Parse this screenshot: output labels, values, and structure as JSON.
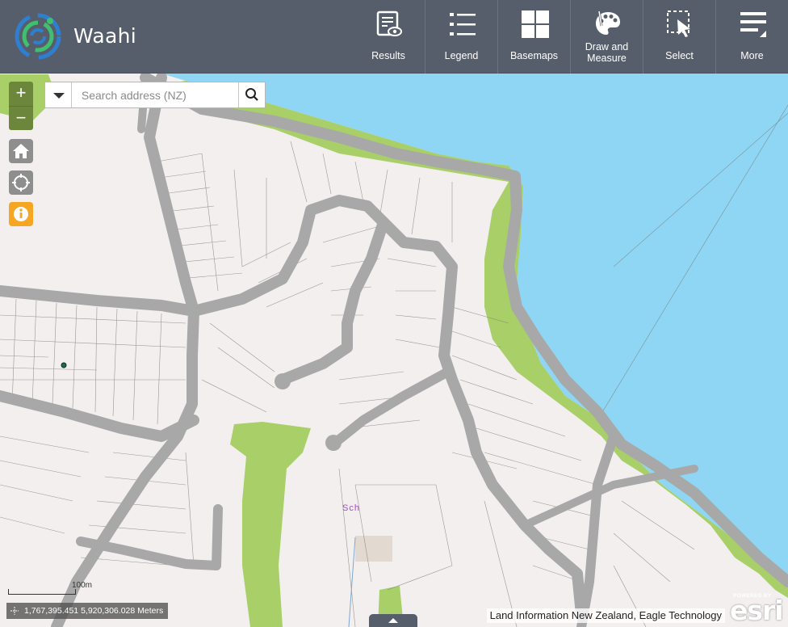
{
  "app": {
    "title": "Waahi"
  },
  "toolbar": {
    "results": "Results",
    "legend": "Legend",
    "basemaps": "Basemaps",
    "draw_line1": "Draw and",
    "draw_line2": "Measure",
    "select": "Select",
    "more": "More"
  },
  "zoom": {
    "in": "+",
    "out": "−"
  },
  "controls": {
    "home_icon": "home-icon",
    "locate_icon": "locate-icon",
    "info_icon": "info-icon"
  },
  "search": {
    "placeholder": "Search address (NZ)",
    "value": ""
  },
  "map": {
    "label_school": "Sch",
    "scale_label": "100m"
  },
  "coordinates": {
    "text": "1,767,395.451 5,920,306.028 Meters"
  },
  "attribution": {
    "text": "Land Information New Zealand, Eagle Technology"
  },
  "esri": {
    "powered_by": "POWERED BY",
    "brand": "esri"
  },
  "colors": {
    "header": "#565e6b",
    "water": "#8ed6f3",
    "park": "#a8cf68",
    "road": "#a8a8a8",
    "land": "#f3efee",
    "zoom": "#6c873c",
    "info": "#f5a623"
  }
}
